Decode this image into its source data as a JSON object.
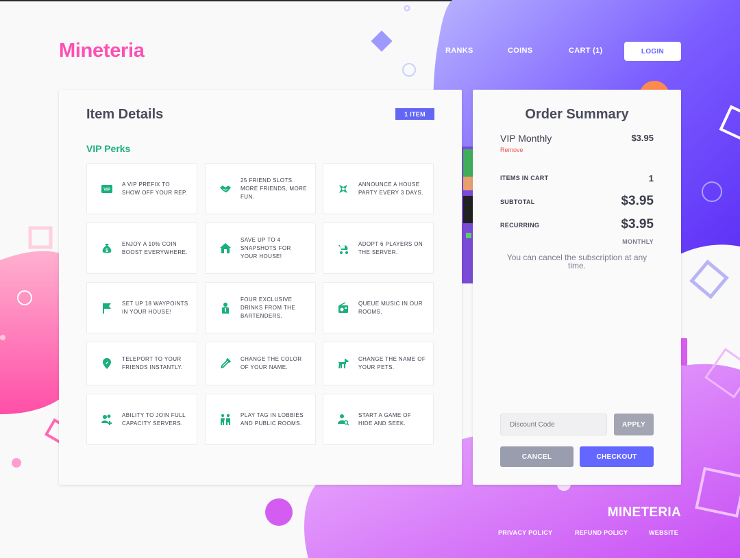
{
  "brand": {
    "logo": "Mineteria",
    "pink": "#ff4fb3",
    "accent": "#6466ff",
    "green": "#1bb07b"
  },
  "nav": {
    "ranks": "RANKS",
    "coins": "COINS",
    "cart": "CART (1)",
    "login": "LOGIN"
  },
  "item_details": {
    "title": "Item Details",
    "badge": "1 ITEM",
    "perks_title": "VIP Perks",
    "perks": [
      {
        "icon": "vip-tag-icon",
        "text": "A VIP prefix to show off your rep."
      },
      {
        "icon": "handshake-icon",
        "text": "25 friend slots. More friends, more fun."
      },
      {
        "icon": "party-icon",
        "text": "Announce a house party every 3 days."
      },
      {
        "icon": "money-bag-icon",
        "text": "Enjoy a 10% coin boost everywhere."
      },
      {
        "icon": "house-icon",
        "text": "Save up to 4 snapshots for your house!"
      },
      {
        "icon": "stroller-icon",
        "text": "Adopt 6 players on the server."
      },
      {
        "icon": "flag-icon",
        "text": "Set up 18 waypoints in your house!"
      },
      {
        "icon": "bartender-icon",
        "text": "Four exclusive drinks from the bartenders."
      },
      {
        "icon": "radio-icon",
        "text": "Queue music in our rooms."
      },
      {
        "icon": "map-pin-icon",
        "text": "Teleport to your friends instantly."
      },
      {
        "icon": "eyedropper-icon",
        "text": "Change the color of your name."
      },
      {
        "icon": "dog-icon",
        "text": "Change the name of your pets."
      },
      {
        "icon": "add-users-icon",
        "text": "Ability to join full capacity servers."
      },
      {
        "icon": "kids-icon",
        "text": "Play tag in lobbies and public rooms."
      },
      {
        "icon": "search-user-icon",
        "text": "Start a game of hide and seek."
      }
    ]
  },
  "order_summary": {
    "title": "Order Summary",
    "item_name": "VIP Monthly",
    "item_price": "$3.95",
    "remove": "Remove",
    "items_in_cart_label": "ITEMS IN CART",
    "items_in_cart_value": "1",
    "subtotal_label": "SUBTOTAL",
    "subtotal_value": "$3.95",
    "recurring_label": "RECURRING",
    "recurring_value": "$3.95",
    "recurring_period": "MONTHLY",
    "note": "You can cancel the subscription at any time.",
    "discount_placeholder": "Discount Code",
    "apply": "APPLY",
    "cancel": "CANCEL",
    "checkout": "CHECKOUT"
  },
  "footer": {
    "logo": "MINETERIA",
    "links": [
      "PRIVACY POLICY",
      "REFUND POLICY",
      "WEBSITE"
    ]
  }
}
